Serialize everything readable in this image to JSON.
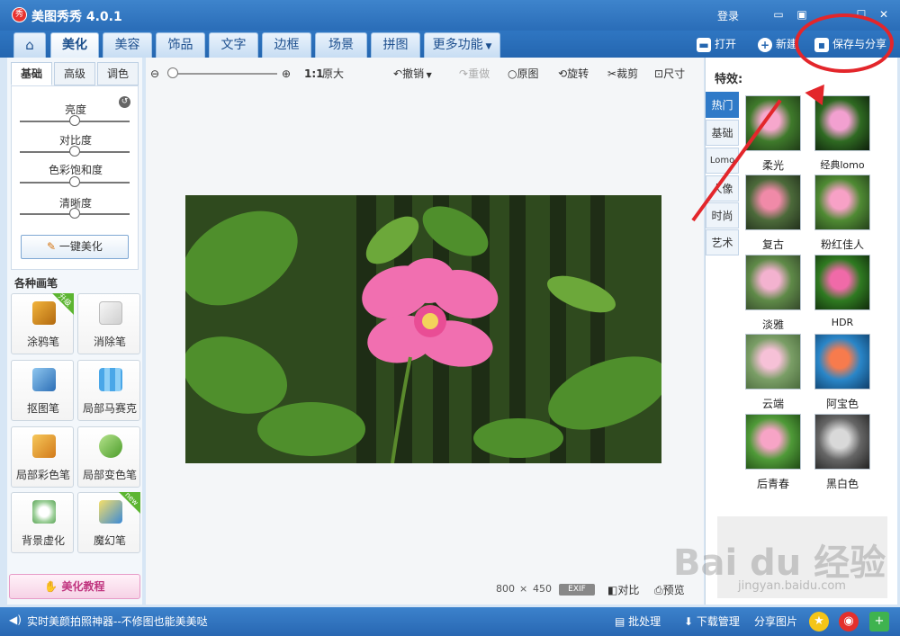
{
  "app": {
    "title": "美图秀秀 4.0.1",
    "login": "登录"
  },
  "tabs": [
    "美化",
    "美容",
    "饰品",
    "文字",
    "边框",
    "场景",
    "拼图",
    "更多功能"
  ],
  "menubar": {
    "open": "打开",
    "new": "新建",
    "save_share": "保存与分享"
  },
  "left": {
    "subtabs": [
      "基础",
      "高级",
      "调色"
    ],
    "sliders": [
      {
        "label": "亮度",
        "value": 0.5
      },
      {
        "label": "对比度",
        "value": 0.5
      },
      {
        "label": "色彩饱和度",
        "value": 0.5
      },
      {
        "label": "清晰度",
        "value": 0.5
      }
    ],
    "one_click": "一键美化",
    "brushes_title": "各种画笔",
    "brushes": [
      "涂鸦笔",
      "消除笔",
      "抠图笔",
      "局部马赛克",
      "局部彩色笔",
      "局部变色笔",
      "背景虚化",
      "魔幻笔"
    ],
    "badge_upgrade": "升级",
    "badge_new": "new",
    "tutorial": "美化教程"
  },
  "canvas": {
    "zoom_1to1": "1:1",
    "zoom_original": "原大",
    "undo": "撤销",
    "redo": "重做",
    "original": "原图",
    "rotate": "旋转",
    "crop": "裁剪",
    "size": "尺寸",
    "width": "800",
    "times": "×",
    "height": "450",
    "exif": "EXIF",
    "compare": "对比",
    "preview": "预览"
  },
  "effects": {
    "title": "特效:",
    "categories": [
      "热门",
      "基础",
      "Lomo",
      "人像",
      "时尚",
      "艺术"
    ],
    "items": [
      "柔光",
      "经典lomo",
      "复古",
      "粉红佳人",
      "淡雅",
      "HDR",
      "云端",
      "阿宝色",
      "后青春",
      "黑白色"
    ]
  },
  "status": {
    "tip": "实时美颜拍照神器--不修图也能美美哒",
    "batch": "批处理",
    "download": "下载管理",
    "share": "分享图片"
  },
  "watermark": {
    "brand": "Bai du 经验",
    "url": "jingyan.baidu.com"
  }
}
